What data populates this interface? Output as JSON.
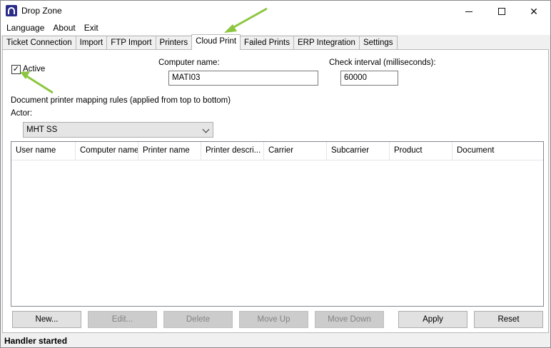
{
  "window": {
    "title": "Drop Zone"
  },
  "menu": {
    "items": [
      "Language",
      "About",
      "Exit"
    ]
  },
  "tabs": [
    "Ticket Connection",
    "Import",
    "FTP Import",
    "Printers",
    "Cloud Print",
    "Failed Prints",
    "ERP Integration",
    "Settings"
  ],
  "active_tab": "Cloud Print",
  "cloud_print": {
    "active_label": "Active",
    "active_checked": true,
    "computer_name_label": "Computer name:",
    "computer_name_value": "MATI03",
    "check_interval_label": "Check interval (milliseconds):",
    "check_interval_value": "60000",
    "rules_label": "Document printer mapping rules (applied from top to bottom)",
    "actor_label": "Actor:",
    "actor_value": "MHT SS",
    "columns": [
      "User name",
      "Computer name",
      "Printer name",
      "Printer descri...",
      "Carrier",
      "Subcarrier",
      "Product",
      "Document"
    ],
    "buttons": {
      "new": "New...",
      "edit": "Edit...",
      "delete": "Delete",
      "move_up": "Move Up",
      "move_down": "Move Down",
      "apply": "Apply",
      "reset": "Reset"
    }
  },
  "status": {
    "text": "Handler started"
  },
  "colors": {
    "annotation_arrow": "#8cc63f",
    "app_icon": "#2b2c88"
  }
}
